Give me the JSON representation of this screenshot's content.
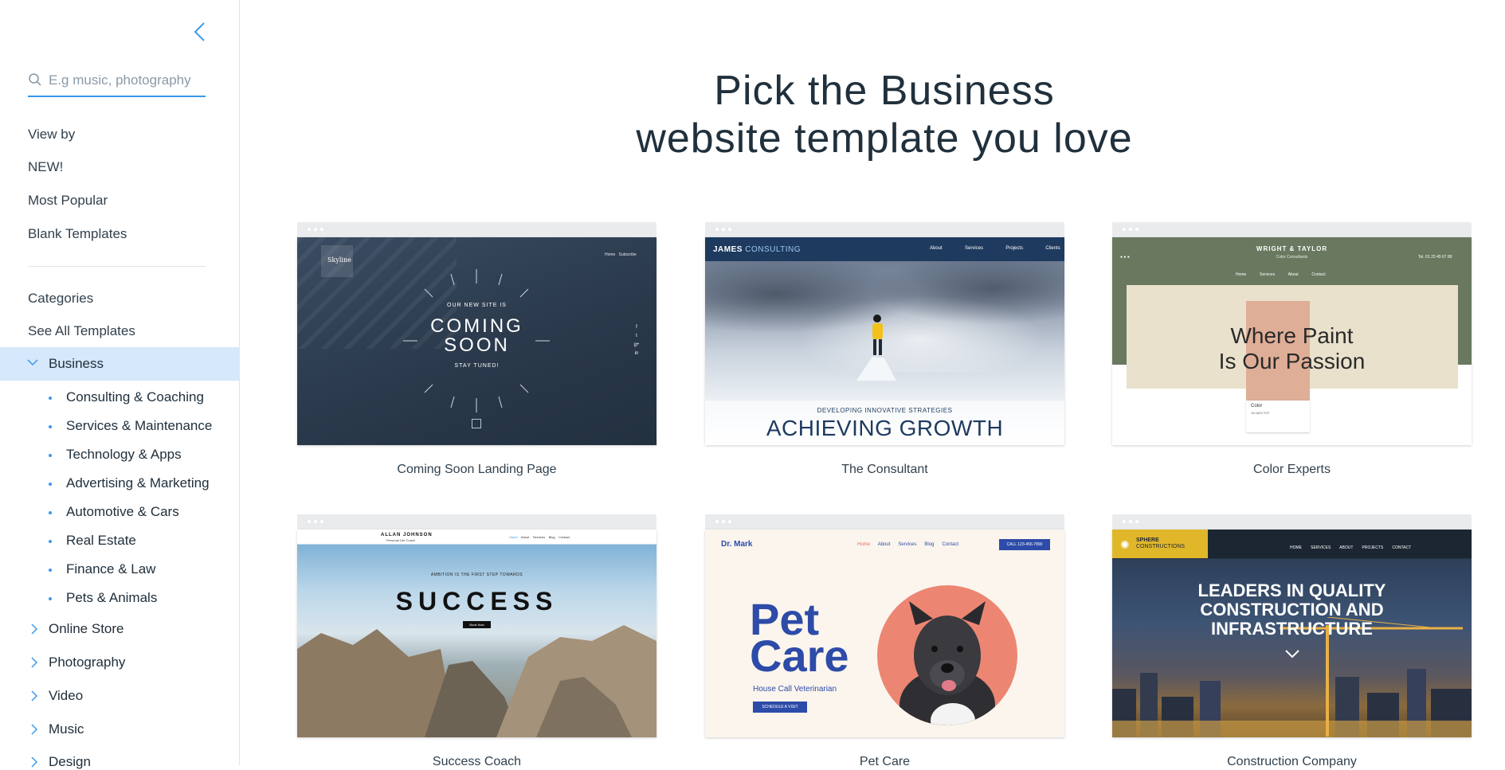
{
  "sidebar": {
    "search_placeholder": "E.g music, photography",
    "view_by": "View by",
    "view_items": [
      "NEW!",
      "Most Popular",
      "Blank Templates"
    ],
    "categories_label": "Categories",
    "see_all": "See All Templates",
    "active_category": "Business",
    "subcategories": [
      "Consulting & Coaching",
      "Services & Maintenance",
      "Technology & Apps",
      "Advertising & Marketing",
      "Automotive & Cars",
      "Real Estate",
      "Finance & Law",
      "Pets & Animals"
    ],
    "other_categories": [
      "Online Store",
      "Photography",
      "Video",
      "Music",
      "Design"
    ]
  },
  "headline": {
    "line1": "Pick the Business",
    "line2": "website template you love"
  },
  "templates": [
    {
      "caption": "Coming Soon Landing Page",
      "logo": "Skyline",
      "nav": [
        "Home",
        "Subscribe"
      ],
      "kicker": "OUR NEW SITE IS",
      "title1": "COMING",
      "title2": "SOON",
      "tagline": "STAY TUNED!",
      "social": [
        "f",
        "t",
        "g+",
        "in"
      ]
    },
    {
      "caption": "The Consultant",
      "brand1": "JAMES",
      "brand2": "CONSULTING",
      "nav": [
        "About",
        "Services",
        "Projects",
        "Clients"
      ],
      "kicker": "DEVELOPING INNOVATIVE STRATEGIES",
      "title": "ACHIEVING GROWTH"
    },
    {
      "caption": "Color Experts",
      "brand": "WRIGHT & TAYLOR",
      "sub": "Color Consultants",
      "phone": "Tel. 01 23 45 67 89",
      "nav": [
        "Home",
        "Services",
        "About",
        "Contact"
      ],
      "title1": "Where Paint",
      "title2": "Is Our Passion",
      "swatch_label": "Color",
      "swatch_code": "19-1622 TCF"
    },
    {
      "caption": "Success Coach",
      "brand": "ALLAN JOHNSON",
      "sub": "Personal Life Coach",
      "nav": [
        "Home",
        "About",
        "Services",
        "Blog",
        "Contact"
      ],
      "kicker": "AMBITION IS THE FIRST STEP TOWARDS",
      "title": "SUCCESS",
      "cta": "Book Now"
    },
    {
      "caption": "Pet Care",
      "brand": "Dr. Mark",
      "nav": [
        "Home",
        "About",
        "Services",
        "Blog",
        "Contact"
      ],
      "phone": "CALL 123-456-7890",
      "title1": "Pet",
      "title2": "Care",
      "sub": "House Call Veterinarian",
      "cta": "SCHEDULE A VISIT"
    },
    {
      "caption": "Construction Company",
      "brand1": "SPHERE",
      "brand2": "CONSTRUCTIONS",
      "nav": [
        "HOME",
        "SERVICES",
        "ABOUT",
        "PROJECTS",
        "CONTACT"
      ],
      "title1": "LEADERS IN QUALITY",
      "title2": "CONSTRUCTION AND",
      "title3": "INFRASTRUCTURE"
    }
  ],
  "colors": {
    "accent": "#3899ec",
    "active_bg": "#d5e8fc",
    "text": "#20303c"
  }
}
